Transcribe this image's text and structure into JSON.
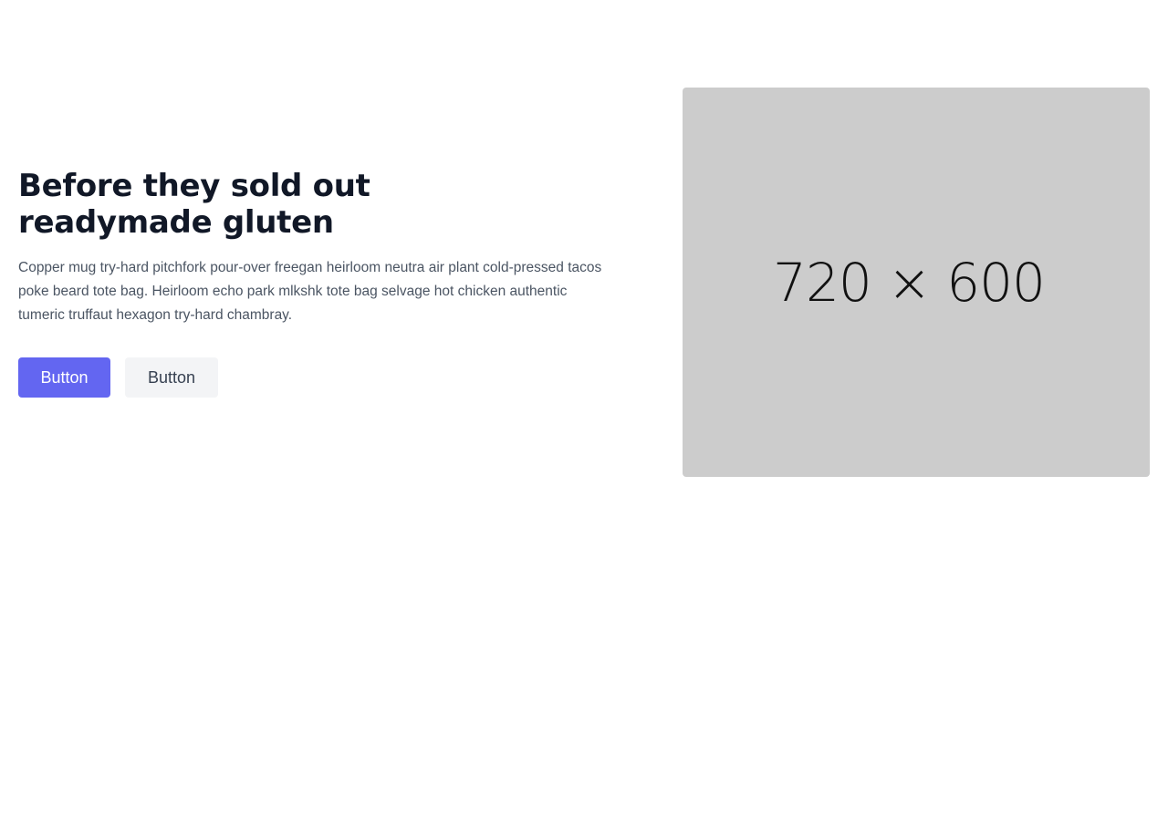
{
  "hero": {
    "title_line1": "Before they sold out",
    "title_line2": "readymade gluten",
    "description": "Copper mug try-hard pitchfork pour-over freegan heirloom neutra air plant cold-pressed tacos poke beard tote bag. Heirloom echo park mlkshk tote bag selvage hot chicken authentic tumeric truffaut hexagon try-hard chambray.",
    "primary_button": "Button",
    "secondary_button": "Button",
    "image_placeholder": "720 × 600"
  },
  "colors": {
    "primary": "#6366f1",
    "secondary_bg": "#f3f4f6",
    "title": "#111827",
    "body_text": "#4b5563",
    "placeholder_bg": "#cccccc"
  }
}
